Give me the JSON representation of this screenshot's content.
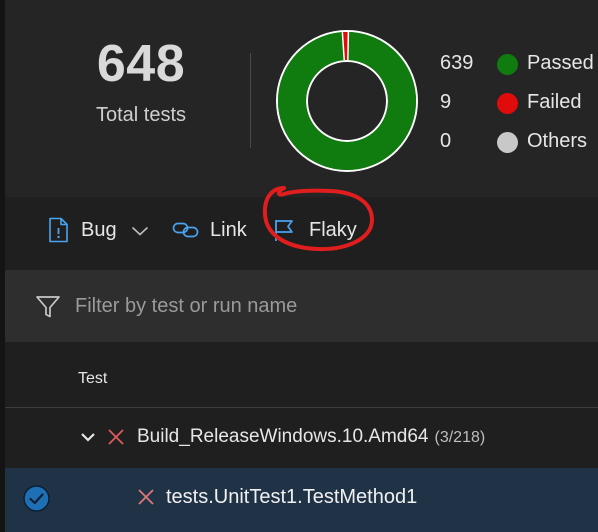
{
  "summary": {
    "total_count": "648",
    "total_label": "Total tests",
    "legend": [
      {
        "count": "639",
        "label": "Passed",
        "color": "#107c10"
      },
      {
        "count": "9",
        "label": "Failed",
        "color": "#e00b0b"
      },
      {
        "count": "0",
        "label": "Others",
        "color": "#c8c8c8"
      }
    ],
    "chart_data": {
      "type": "pie",
      "categories": [
        "Passed",
        "Failed",
        "Others"
      ],
      "values": [
        639,
        9,
        0
      ],
      "colors": [
        "#107c10",
        "#e00b0b",
        "#c8c8c8"
      ]
    }
  },
  "toolbar": {
    "bug_label": "Bug",
    "bug_icon": "bug-report-icon",
    "dropdown_icon": "chevron-down-icon",
    "link_label": "Link",
    "link_icon": "link-icon",
    "flaky_label": "Flaky",
    "flaky_icon": "flag-icon",
    "annotation_color": "#e01e1e"
  },
  "filter": {
    "placeholder": "Filter by test or run name",
    "icon": "filter-icon"
  },
  "table": {
    "columns": [
      "Test"
    ],
    "group_row": {
      "name": "Build_ReleaseWindows.10.Amd64",
      "count": "(3/218)",
      "status_icon": "failed-x-icon"
    },
    "child_row": {
      "name": "tests.UnitTest1.TestMethod1",
      "status_icon": "failed-x-icon",
      "selected": true
    }
  },
  "colors": {
    "background": "#1f1f1f",
    "panel": "#252525",
    "filter_bar": "#2e2e2e",
    "selected_row": "#203246",
    "accent": "#4aa3f0",
    "fail_x": "#e05a5a"
  }
}
